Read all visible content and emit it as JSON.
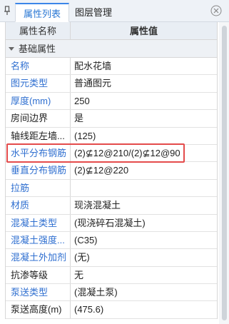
{
  "tabs": [
    {
      "label": "属性列表",
      "active": true
    },
    {
      "label": "图层管理",
      "active": false
    }
  ],
  "header": {
    "name_col": "属性名称",
    "value_col": "属性值"
  },
  "group": {
    "label": "基础属性"
  },
  "rows": [
    {
      "name": "名称",
      "value": "配水花墙",
      "color": "blue"
    },
    {
      "name": "图元类型",
      "value": "普通图元",
      "color": "blue"
    },
    {
      "name": "厚度(mm)",
      "value": "250",
      "color": "blue"
    },
    {
      "name": "房间边界",
      "value": "是",
      "color": "dark"
    },
    {
      "name": "轴线距左墙...",
      "value": "(125)",
      "color": "dark"
    },
    {
      "name": "水平分布钢筋",
      "value": "(2)⊈12@210/(2)⊈12@90",
      "color": "blue"
    },
    {
      "name": "垂直分布钢筋",
      "value": "(2)⊈12@220",
      "color": "blue"
    },
    {
      "name": "拉筋",
      "value": "",
      "color": "blue"
    },
    {
      "name": "材质",
      "value": "现浇混凝土",
      "color": "blue"
    },
    {
      "name": "混凝土类型",
      "value": "(现浇碎石混凝土)",
      "color": "blue"
    },
    {
      "name": "混凝土强度...",
      "value": "(C35)",
      "color": "blue"
    },
    {
      "name": "混凝土外加剂",
      "value": "(无)",
      "color": "blue"
    },
    {
      "name": "抗渗等级",
      "value": "无",
      "color": "dark"
    },
    {
      "name": "泵送类型",
      "value": "(混凝土泵)",
      "color": "blue"
    },
    {
      "name": "泵送高度(m)",
      "value": "(475.6)",
      "color": "dark"
    }
  ],
  "colors": {
    "accent": "#2b78d4",
    "highlight": "#e44b4b",
    "property_name_blue": "#2f6fd0"
  },
  "icons": {
    "pin": "pin-icon",
    "close": "close-icon"
  }
}
